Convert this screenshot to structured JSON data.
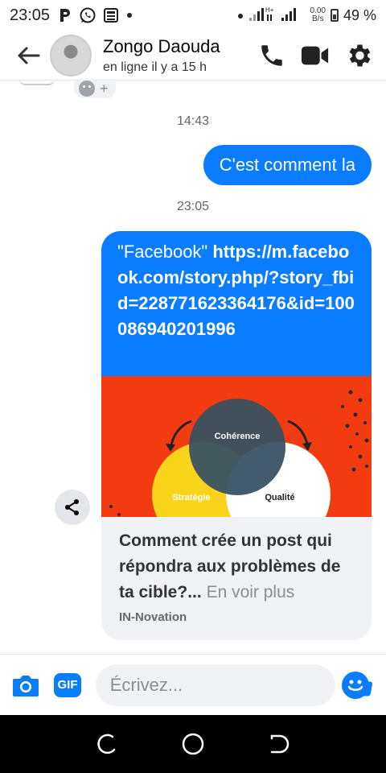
{
  "status_bar": {
    "time": "23:05",
    "net_speed_value": "0.00",
    "net_speed_unit": "B/s",
    "network_type": "H+",
    "battery": "49 %",
    "icons": [
      "parking-app-icon",
      "whatsapp-icon",
      "news-icon",
      "dot-icon",
      "signal-icon",
      "battery-icon"
    ]
  },
  "header": {
    "contact_name": "Zongo Daouda",
    "contact_status": "en ligne il y a 15 h",
    "icons": [
      "back-arrow-icon",
      "phone-icon",
      "video-icon",
      "gear-icon"
    ]
  },
  "chat": {
    "reaction_add": "+",
    "messages": [
      {
        "type": "timestamp",
        "text": "14:43"
      },
      {
        "type": "outgoing",
        "text": "C'est comment la"
      },
      {
        "type": "timestamp",
        "text": "23:05"
      },
      {
        "type": "link",
        "prefix": "\"Facebook\" ",
        "url": "https://m.facebook.com/story.php/?story_fbid=228771623364176&id=100086940201996",
        "preview": {
          "image_labels": [
            "Cohérence",
            "Stratégie",
            "Qualité"
          ],
          "title": "Comment crée un post qui répondra aux problèmes de ta cible?",
          "ellipsis": "...",
          "more": "En voir plus",
          "source": "IN-Novation"
        }
      }
    ]
  },
  "composer": {
    "gif_label": "GIF",
    "placeholder": "Écrivez...",
    "icons": [
      "camera-icon",
      "gif-icon",
      "emoji-icon",
      "thumbs-up-icon"
    ]
  },
  "colors": {
    "accent": "#0a7cff",
    "preview_bg": "#f33b12",
    "circle_dark": "#2a3f4d",
    "circle_yellow": "#f8d41a"
  }
}
